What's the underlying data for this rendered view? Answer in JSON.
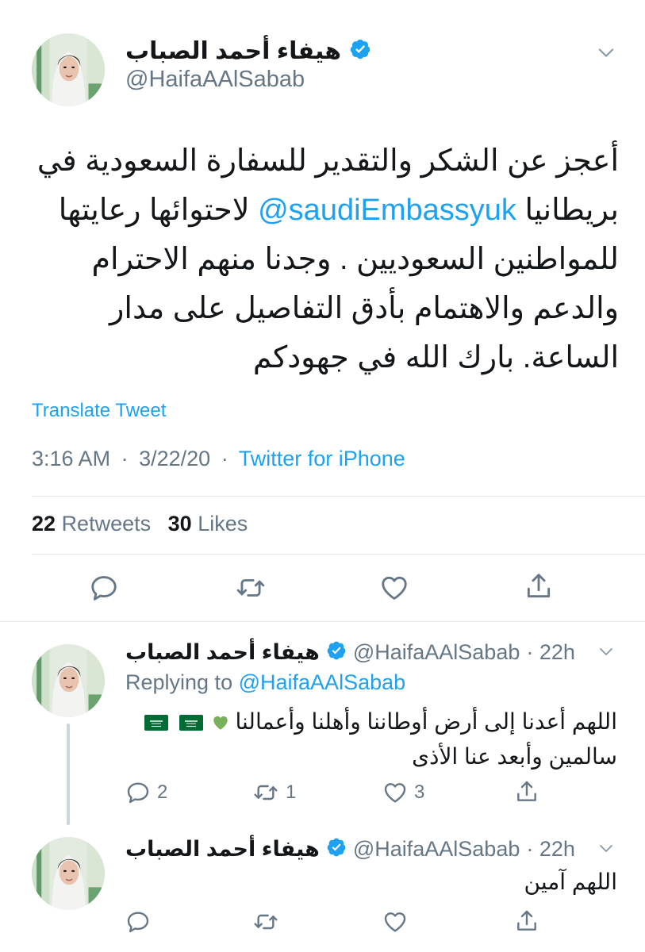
{
  "main_tweet": {
    "author_name": "هيفاء أحمد الصباب",
    "author_handle": "@HaifaAAlSabab",
    "text_line1": "أعجز عن الشكر والتقدير للسفارة السعودية في",
    "text_line2_before_mention": "بريطانيا",
    "text_line2_mention": "@saudiEmbassyuk",
    "text_line2_after_mention": "لاحتوائها رعايتها",
    "text_line3": "للمواطنين السعوديين . وجدنا منهم الاحترام",
    "text_line4": "والدعم والاهتمام بأدق التفاصيل على مدار",
    "text_line5": "الساعة. بارك الله في جهودكم",
    "translate_label": "Translate Tweet",
    "time": "3:16 AM",
    "date": "3/22/20",
    "separator": "·",
    "source": "Twitter for iPhone",
    "retweets_count": "22",
    "retweets_label": "Retweets",
    "likes_count": "30",
    "likes_label": "Likes"
  },
  "reply1": {
    "author_name": "هيفاء أحمد الصباب",
    "author_handle": "@HaifaAAlSabab",
    "time_ago": "· 22h",
    "replying_label": "Replying to",
    "replying_to": "@HaifaAAlSabab",
    "text_line1": "اللهم أعدنا إلى أرض أوطاننا وأهلنا وأعمالنا",
    "text_line2": "سالمين وأبعد عنا الأذى",
    "reply_count": "2",
    "retweet_count": "1",
    "like_count": "3"
  },
  "reply2": {
    "author_name": "هيفاء أحمد الصباب",
    "author_handle": "@HaifaAAlSabab",
    "time_ago": "· 22h",
    "text_line1": "اللهم آمين"
  },
  "colors": {
    "link": "#1da1f2",
    "muted": "#657786",
    "verified": "#1da1f2",
    "divider": "#e1e8ed",
    "heart_emoji": "#7ac943",
    "flag_green": "#006c35"
  },
  "icons": [
    "verified-icon",
    "chevron-down-icon",
    "reply-icon",
    "retweet-icon",
    "like-icon",
    "share-icon",
    "saudi-flag-icon",
    "green-heart-icon"
  ]
}
